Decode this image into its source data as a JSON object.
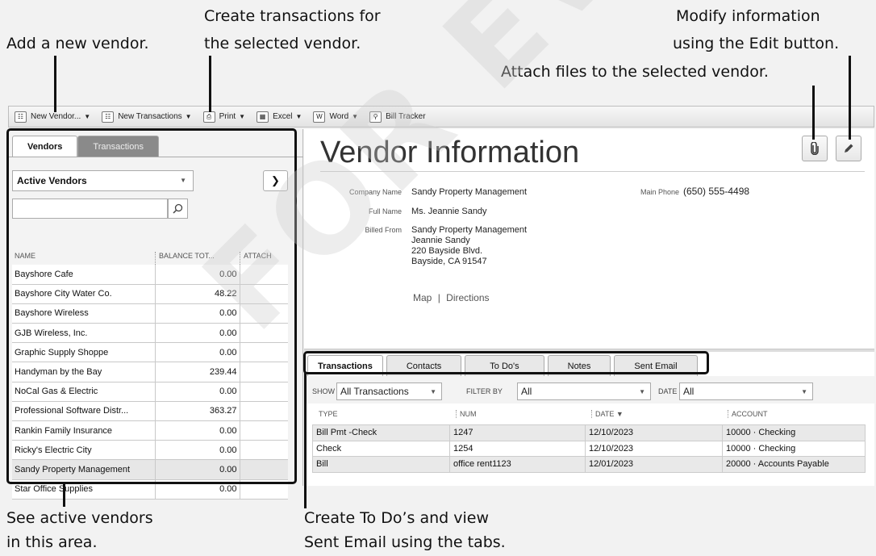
{
  "callouts": {
    "add_vendor": "Add a new vendor.",
    "create_tx_1": "Create transactions for",
    "create_tx_2": "the selected vendor.",
    "modify_1": "Modify information",
    "modify_2": "using the Edit button.",
    "attach": "Attach files to the selected vendor.",
    "active_1": "See active vendors",
    "active_2": "in this area.",
    "todo_1": "Create To Do’s and view",
    "todo_2": "Sent Email using the tabs."
  },
  "watermark": "FOR EVALUATION ONLY",
  "toolbar": {
    "new_vendor": "New Vendor...",
    "new_transactions": "New Transactions",
    "print": "Print",
    "excel": "Excel",
    "word": "Word",
    "bill_tracker": "Bill Tracker"
  },
  "left": {
    "tab_vendors": "Vendors",
    "tab_transactions": "Transactions",
    "dropdown": "Active Vendors",
    "search_placeholder": "",
    "columns": [
      "NAME",
      "BALANCE TOT...",
      "ATTACH"
    ],
    "vendors": [
      {
        "name": "Bayshore Cafe",
        "balance": "0.00"
      },
      {
        "name": "Bayshore City Water Co.",
        "balance": "48.22"
      },
      {
        "name": "Bayshore Wireless",
        "balance": "0.00"
      },
      {
        "name": "GJB Wireless, Inc.",
        "balance": "0.00"
      },
      {
        "name": "Graphic Supply Shoppe",
        "balance": "0.00"
      },
      {
        "name": "Handyman by the Bay",
        "balance": "239.44"
      },
      {
        "name": "NoCal Gas & Electric",
        "balance": "0.00"
      },
      {
        "name": "Professional Software Distr...",
        "balance": "363.27"
      },
      {
        "name": "Rankin Family Insurance",
        "balance": "0.00"
      },
      {
        "name": "Ricky's Electric City",
        "balance": "0.00"
      },
      {
        "name": "Sandy Property Management",
        "balance": "0.00"
      },
      {
        "name": "Star Office Supplies",
        "balance": "0.00"
      }
    ]
  },
  "info": {
    "title": "Vendor Information",
    "company_name_label": "Company Name",
    "company_name": "Sandy Property Management",
    "full_name_label": "Full Name",
    "full_name": "Ms. Jeannie  Sandy",
    "billed_from_label": "Billed From",
    "billed_from": [
      "Sandy Property Management",
      "Jeannie Sandy",
      "220 Bayside Blvd.",
      "Bayside, CA 91547"
    ],
    "main_phone_label": "Main Phone",
    "main_phone": "(650) 555-4498",
    "map": "Map",
    "directions": "Directions"
  },
  "bottom": {
    "tabs": [
      "Transactions",
      "Contacts",
      "To Do's",
      "Notes",
      "Sent Email"
    ],
    "show_label": "SHOW",
    "show_value": "All Transactions",
    "filter_label": "FILTER BY",
    "filter_value": "All",
    "date_label": "DATE",
    "date_value": "All",
    "columns": [
      "TYPE",
      "NUM",
      "DATE ▼",
      "ACCOUNT"
    ],
    "rows": [
      [
        "Bill Pmt -Check",
        "1247",
        "12/10/2023",
        "10000 · Checking"
      ],
      [
        "Check",
        "1254",
        "12/10/2023",
        "10000 · Checking"
      ],
      [
        "Bill",
        "office rent1123",
        "12/01/2023",
        "20000 · Accounts Payable"
      ]
    ]
  }
}
